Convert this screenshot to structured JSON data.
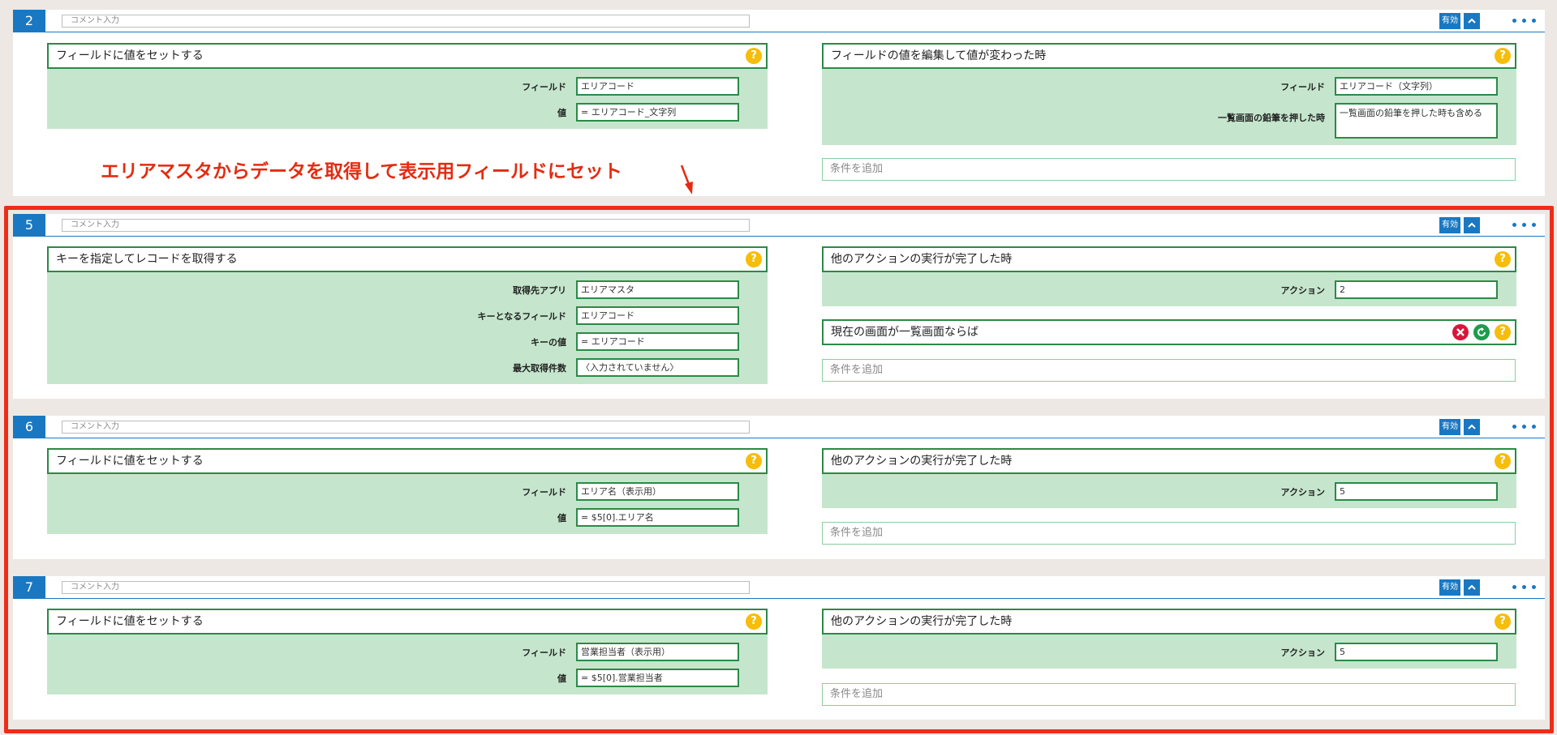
{
  "badges": {
    "enabled": "有効"
  },
  "help_glyph": "?",
  "annotation": "エリアマスタからデータを取得して表示用フィールドにセット",
  "colors": {
    "accent": "#1a78c2",
    "green_border": "#2a8a47",
    "green_fill": "#c5e6cd",
    "help": "#f6bd0a",
    "highlight": "#ee2d18"
  },
  "rows": [
    {
      "number": "2",
      "comment_placeholder": "コメント入力",
      "action": {
        "title": "フィールドに値をセットする",
        "fields": [
          {
            "label": "フィールド",
            "value": "エリアコード"
          },
          {
            "label": "値",
            "value": "= エリアコード_文字列"
          }
        ]
      },
      "condition": {
        "title": "フィールドの値を編集して値が変わった時",
        "fields": [
          {
            "label": "フィールド",
            "value": "エリアコード（文字列）"
          },
          {
            "label": "一覧画面の鉛筆を押した時",
            "value": "一覧画面の鉛筆を押した時も含める"
          }
        ]
      },
      "add_condition": "条件を追加"
    },
    {
      "number": "5",
      "comment_placeholder": "コメント入力",
      "action": {
        "title": "キーを指定してレコードを取得する",
        "fields": [
          {
            "label": "取得先アプリ",
            "value": "エリアマスタ"
          },
          {
            "label": "キーとなるフィールド",
            "value": "エリアコード"
          },
          {
            "label": "キーの値",
            "value": "= エリアコード"
          },
          {
            "label": "最大取得件数",
            "value": "〈入力されていません〉"
          }
        ]
      },
      "condition": {
        "title": "他のアクションの実行が完了した時",
        "fields": [
          {
            "label": "アクション",
            "value": "2"
          }
        ]
      },
      "extra_condition": {
        "title": "現在の画面が一覧画面ならば",
        "icons": [
          "remove-icon",
          "refresh-icon",
          "help-icon"
        ]
      },
      "add_condition": "条件を追加"
    },
    {
      "number": "6",
      "comment_placeholder": "コメント入力",
      "action": {
        "title": "フィールドに値をセットする",
        "fields": [
          {
            "label": "フィールド",
            "value": "エリア名（表示用）"
          },
          {
            "label": "値",
            "value": "= $5[0].エリア名"
          }
        ]
      },
      "condition": {
        "title": "他のアクションの実行が完了した時",
        "fields": [
          {
            "label": "アクション",
            "value": "5"
          }
        ]
      },
      "add_condition": "条件を追加"
    },
    {
      "number": "7",
      "comment_placeholder": "コメント入力",
      "action": {
        "title": "フィールドに値をセットする",
        "fields": [
          {
            "label": "フィールド",
            "value": "営業担当者（表示用）"
          },
          {
            "label": "値",
            "value": "= $5[0].営業担当者"
          }
        ]
      },
      "condition": {
        "title": "他のアクションの実行が完了した時",
        "fields": [
          {
            "label": "アクション",
            "value": "5"
          }
        ]
      },
      "add_condition": "条件を追加"
    }
  ]
}
